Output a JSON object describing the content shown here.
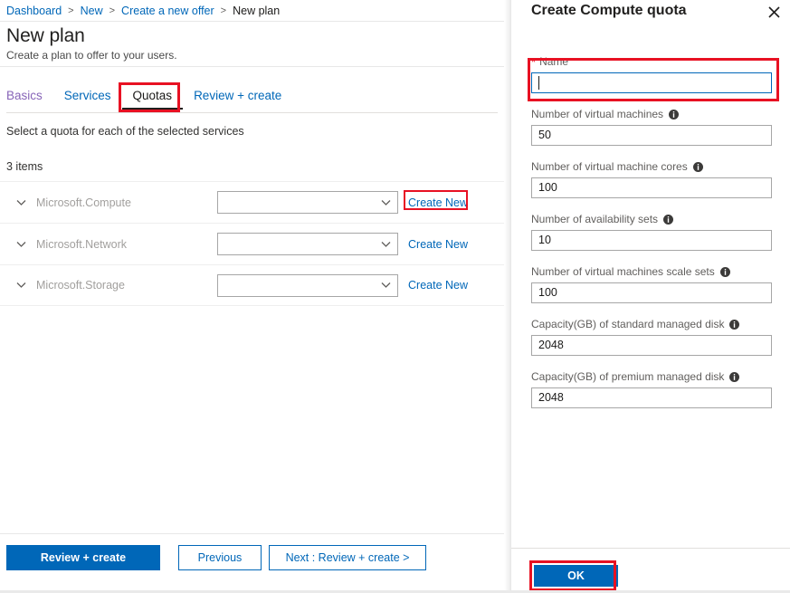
{
  "breadcrumb": {
    "items": [
      {
        "label": "Dashboard",
        "current": false
      },
      {
        "label": "New",
        "current": false
      },
      {
        "label": "Create a new offer",
        "current": false
      },
      {
        "label": "New plan",
        "current": true
      }
    ],
    "separator": ">"
  },
  "blade": {
    "title": "New plan",
    "subtitle": "Create a plan to offer to your users.",
    "tabs": [
      {
        "label": "Basics",
        "state": "visited"
      },
      {
        "label": "Services",
        "state": "link"
      },
      {
        "label": "Quotas",
        "state": "active"
      },
      {
        "label": "Review + create",
        "state": "link"
      }
    ],
    "section_hint": "Select a quota for each of the selected services",
    "item_count": "3 items",
    "quota_rows": [
      {
        "name": "Microsoft.Compute",
        "selected": "",
        "create_label": "Create New",
        "chevron": "chevron-down-icon"
      },
      {
        "name": "Microsoft.Network",
        "selected": "",
        "create_label": "Create New",
        "chevron": "chevron-down-icon"
      },
      {
        "name": "Microsoft.Storage",
        "selected": "",
        "create_label": "Create New",
        "chevron": "chevron-down-icon"
      }
    ],
    "footer": {
      "review_create": "Review + create",
      "previous": "Previous",
      "next": "Next : Review + create >"
    }
  },
  "panel": {
    "title": "Create Compute quota",
    "close_icon": "close-icon",
    "fields": [
      {
        "label": "Name",
        "required": true,
        "value": "",
        "has_info": false,
        "focused": true
      },
      {
        "label": "Number of virtual machines",
        "required": false,
        "value": "50",
        "has_info": true,
        "focused": false
      },
      {
        "label": "Number of virtual machine cores",
        "required": false,
        "value": "100",
        "has_info": true,
        "focused": false
      },
      {
        "label": "Number of availability sets",
        "required": false,
        "value": "10",
        "has_info": true,
        "focused": false
      },
      {
        "label": "Number of virtual machines scale sets",
        "required": false,
        "value": "100",
        "has_info": true,
        "focused": false
      },
      {
        "label": "Capacity(GB) of standard managed disk",
        "required": false,
        "value": "2048",
        "has_info": true,
        "focused": false
      },
      {
        "label": "Capacity(GB) of premium managed disk",
        "required": false,
        "value": "2048",
        "has_info": true,
        "focused": false
      }
    ],
    "ok_label": "OK"
  },
  "colors": {
    "accent_blue": "#0067b8",
    "highlight_red": "#e81123",
    "visited_purple": "#8764b8",
    "muted_text": "#a19f9d",
    "label_text": "#605e5c"
  }
}
